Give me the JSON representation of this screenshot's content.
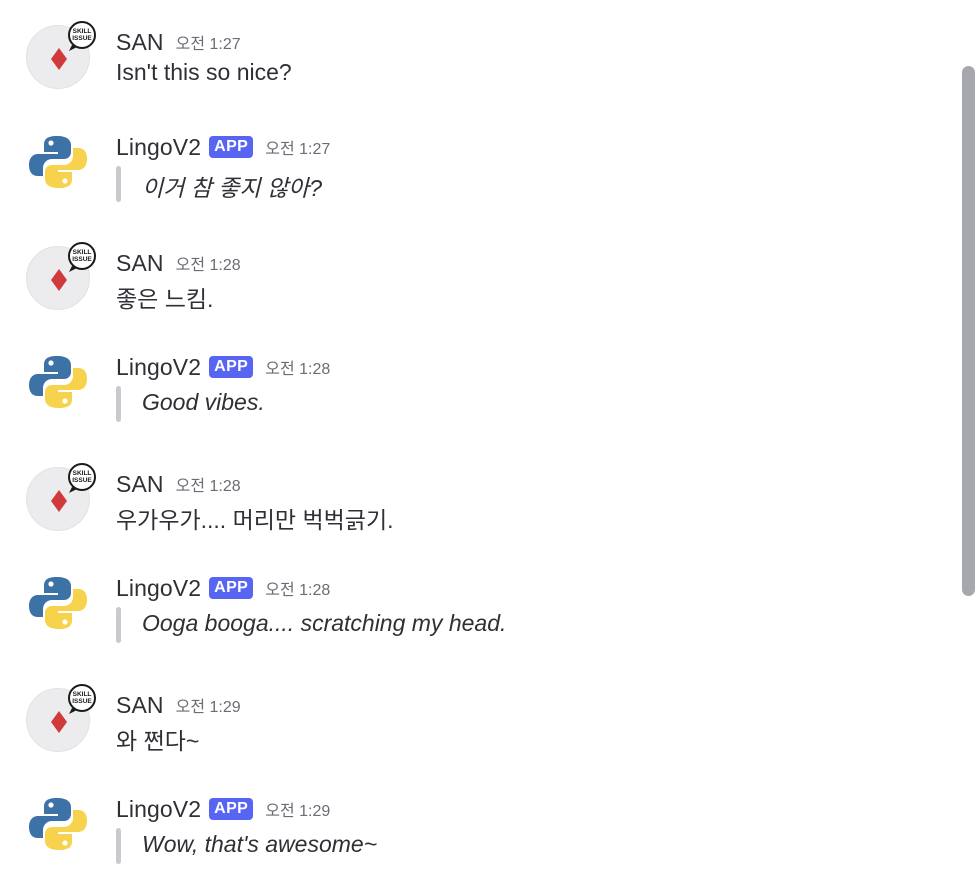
{
  "messages": [
    {
      "author": "SAN",
      "time": "오전 1:27",
      "kind": "plain",
      "text": "Isn't this so nice?"
    },
    {
      "author": "LingoV2",
      "badge": "APP",
      "time": "오전 1:27",
      "kind": "quote",
      "text": "이거 참 좋지 않아?"
    },
    {
      "author": "SAN",
      "time": "오전 1:28",
      "kind": "plain",
      "text": "좋은 느킴."
    },
    {
      "author": "LingoV2",
      "badge": "APP",
      "time": "오전 1:28",
      "kind": "quote",
      "text": "Good vibes."
    },
    {
      "author": "SAN",
      "time": "오전 1:28",
      "kind": "plain",
      "text": "우가우가.... 머리만 벅벅긁기."
    },
    {
      "author": "LingoV2",
      "badge": "APP",
      "time": "오전 1:28",
      "kind": "quote",
      "text": "Ooga booga.... scratching my head."
    },
    {
      "author": "SAN",
      "time": "오전 1:29",
      "kind": "plain",
      "text": "와 쩐다~"
    },
    {
      "author": "LingoV2",
      "badge": "APP",
      "time": "오전 1:29",
      "kind": "quote",
      "text": "Wow, that's awesome~"
    }
  ],
  "avatars": {
    "san": {
      "icon": "diamond-skill-issue-icon",
      "bubble_text_line1": "SKILL",
      "bubble_text_line2": "ISSUE",
      "diamond_color": "#d13a3a"
    },
    "lingo": {
      "icon": "python-logo-icon",
      "blue": "#3d72a6",
      "yellow": "#f7d24c"
    }
  },
  "colors": {
    "app_badge": "#5865f2",
    "text": "#2e3035",
    "timestamp": "#6a6d75",
    "quote_bar": "#c9cacf",
    "scrollbar_thumb": "#a7a8ad"
  }
}
